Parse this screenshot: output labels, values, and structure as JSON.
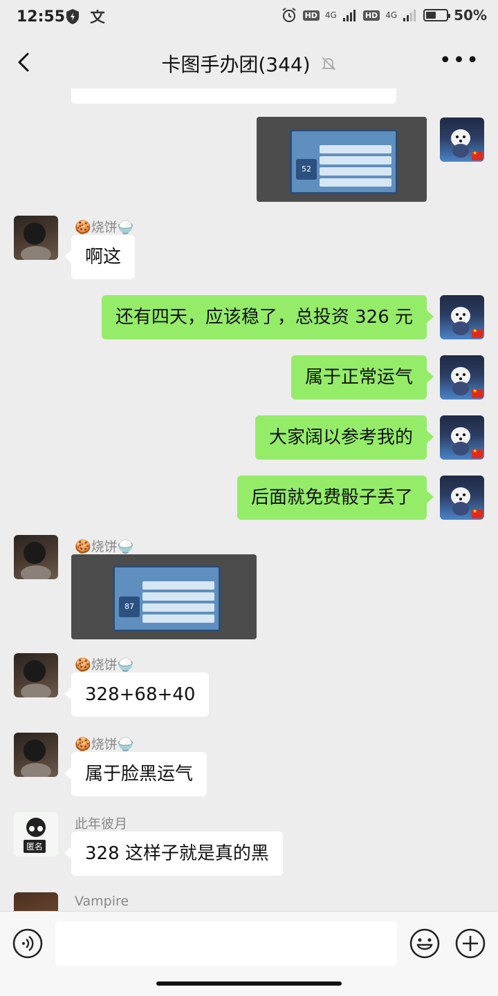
{
  "status": {
    "time": "12:55",
    "hd1": "HD",
    "sig1": "4G",
    "hd2": "HD",
    "sig2": "4G",
    "battery_text": "50%",
    "battery_level": 0.5
  },
  "header": {
    "title": "卡图手办团(344)"
  },
  "messages": {
    "m1": {
      "image_number": "52"
    },
    "m2": {
      "sender": "🍪烧饼🍚",
      "text": "啊这"
    },
    "m3": {
      "text": "还有四天，应该稳了，总投资 326 元"
    },
    "m4": {
      "text": "属于正常运气"
    },
    "m5": {
      "text": "大家阔以参考我的"
    },
    "m6": {
      "text": "后面就免费骰子丢了"
    },
    "m7": {
      "sender": "🍪烧饼🍚",
      "image_number": "87"
    },
    "m8": {
      "sender": "🍪烧饼🍚",
      "text": "328+68+40"
    },
    "m9": {
      "sender": "🍪烧饼🍚",
      "text": "属于脸黑运气"
    },
    "m10": {
      "sender": "此年彼月",
      "text": "328 这样子就是真的黑",
      "avatar_badge": "匿名"
    },
    "m11": {
      "sender": "Vampire"
    }
  },
  "input": {
    "placeholder": ""
  },
  "colors": {
    "bubble_self": "#95ec69",
    "bubble_other": "#ffffff",
    "background": "#ededed"
  }
}
